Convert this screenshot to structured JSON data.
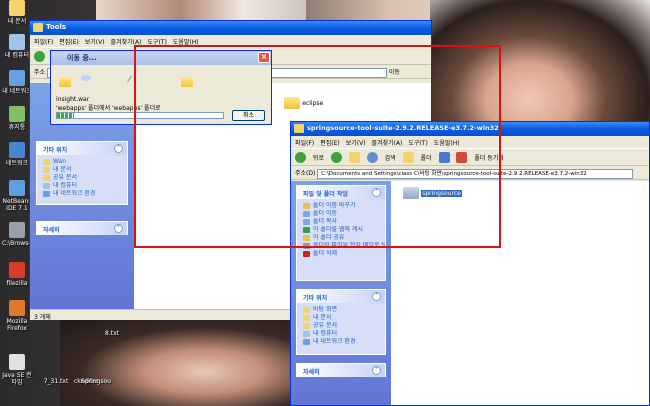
{
  "desktop": {
    "icons": [
      {
        "label": "내 문서",
        "color": "#f5d36a"
      },
      {
        "label": "내 컴퓨터",
        "color": "#9fc3ea"
      },
      {
        "label": "내 네트워크",
        "color": "#6aa0e0"
      },
      {
        "label": "휴지통",
        "color": "#7fbf6a"
      },
      {
        "label": "네트워크",
        "color": "#4a86d0"
      },
      {
        "label": "NetBeans IDE 7.1",
        "color": "#5fa0d8"
      },
      {
        "label": "C:\\Browse",
        "color": "#9aa0a8"
      },
      {
        "label": "filezilla",
        "color": "#d83b2b"
      },
      {
        "label": "Mozilla Firefox",
        "color": "#e07a2a"
      },
      {
        "label": "Java SE 런타임",
        "color": "#e0e0e0"
      }
    ],
    "bottom_icons": [
      "7_31.txt",
      "ckeditor",
      "Springsou",
      "8.txt"
    ]
  },
  "tools_window": {
    "title": "Tools",
    "menu": [
      "파일(F)",
      "편집(E)",
      "보기(V)",
      "즐겨찾기(A)",
      "도구(T)",
      "도움말(H)"
    ],
    "address_label": "주소",
    "go_label": "이동",
    "folder_item": "eclipse",
    "sidebar_other_title": "기타 위치",
    "sidebar_other_items": [
      "Wan",
      "내 문서",
      "공유 문서",
      "내 컴퓨터",
      "내 네트워크 환경"
    ],
    "sidebar_details_title": "자세히",
    "status": "3 개체"
  },
  "move_dialog": {
    "title": "이동 중...",
    "file_name": "insight.war",
    "progress_text": "'webapps' 폴더에서 'webapps' 폴더로",
    "progress": 0.1,
    "cancel_label": "취소"
  },
  "sts_window": {
    "title": "springsource-tool-suite-2.9.2.RELEASE-e3.7.2-win32",
    "menu": [
      "파일(F)",
      "편집(E)",
      "보기(V)",
      "즐겨찾기(A)",
      "도구(T)",
      "도움말(H)"
    ],
    "toolbar": {
      "back": "뒤로",
      "search": "검색",
      "folders": "폴더",
      "sync": "폴더 동기화"
    },
    "address_label": "주소(D)",
    "address_value": "C:\\Documents and Settings\\class C\\바탕 화면\\springsource-tool-suite-2.9.2.RELEASE-e3.7.2-win32",
    "folder_item": "springsource",
    "tasks_title": "파일 및 폴더 작업",
    "tasks": [
      {
        "label": "폴더 이름 바꾸기",
        "color": "#e8c050"
      },
      {
        "label": "폴더 이동",
        "color": "#7aa8e0"
      },
      {
        "label": "폴더 복사",
        "color": "#7aa8e0"
      },
      {
        "label": "이 폴더를 웹에 게시",
        "color": "#3a9a4a"
      },
      {
        "label": "이 폴더 공유",
        "color": "#e8c050"
      },
      {
        "label": "폴더의 파일을 전자 메일로 보내기",
        "color": "#8a9aa8"
      },
      {
        "label": "폴더 삭제",
        "color": "#d02020"
      }
    ],
    "other_title": "기타 위치",
    "other_items": [
      "바탕 화면",
      "내 문서",
      "공유 문서",
      "내 컴퓨터",
      "내 네트워크 환경"
    ],
    "details_title": "자세히"
  }
}
